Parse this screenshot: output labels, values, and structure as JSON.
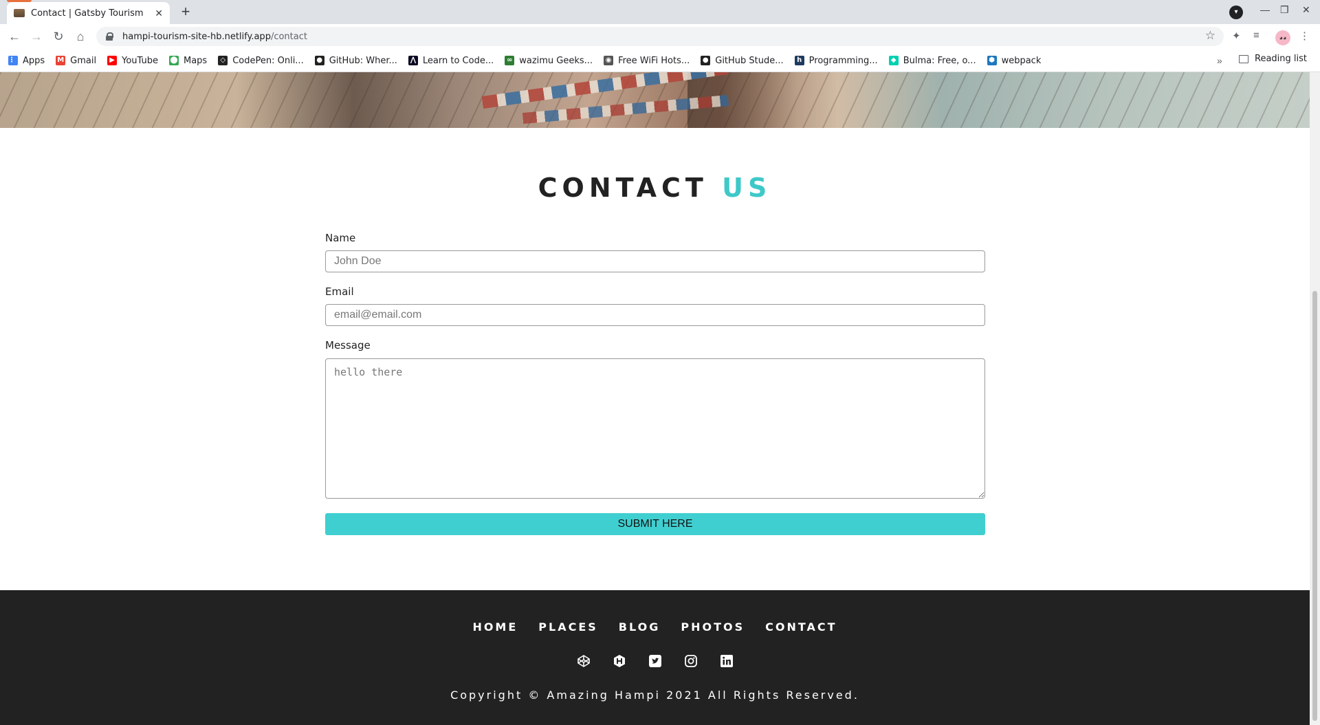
{
  "browser": {
    "tab_title": "Contact | Gatsby Tourism",
    "url_host": "hampi-tourism-site-hb.netlify.app",
    "url_path": "/contact",
    "bookmarks": [
      {
        "label": "Apps",
        "icon": "apps-grid-icon",
        "color": "#4285f4"
      },
      {
        "label": "Gmail",
        "icon": "gmail-icon",
        "color": "#ea4335"
      },
      {
        "label": "YouTube",
        "icon": "youtube-icon",
        "color": "#ff0000"
      },
      {
        "label": "Maps",
        "icon": "maps-icon",
        "color": "#34a853"
      },
      {
        "label": "CodePen: Onli...",
        "icon": "codepen-icon",
        "color": "#222222"
      },
      {
        "label": "GitHub: Wher...",
        "icon": "github-icon",
        "color": "#222222"
      },
      {
        "label": "Learn to Code...",
        "icon": "freecodecamp-icon",
        "color": "#0a0a23"
      },
      {
        "label": "wazimu Geeks...",
        "icon": "wazimu-icon",
        "color": "#2e7d32"
      },
      {
        "label": "Free WiFi Hots...",
        "icon": "wifi-globe-icon",
        "color": "#555555"
      },
      {
        "label": "GitHub Stude...",
        "icon": "github-icon",
        "color": "#222222"
      },
      {
        "label": "Programming...",
        "icon": "hashnode-icon",
        "color": "#1e3a5f"
      },
      {
        "label": "Bulma: Free, o...",
        "icon": "bulma-icon",
        "color": "#00d1b2"
      },
      {
        "label": "webpack",
        "icon": "webpack-icon",
        "color": "#1c78c0"
      }
    ],
    "reading_list": "Reading list"
  },
  "contact": {
    "title_main": "CONTACT",
    "title_accent": "US",
    "name_label": "Name",
    "name_placeholder": "John Doe",
    "email_label": "Email",
    "email_placeholder": "email@email.com",
    "message_label": "Message",
    "message_placeholder": "hello there",
    "submit_label": "SUBMIT HERE"
  },
  "footer": {
    "links": [
      "HOME",
      "PLACES",
      "BLOG",
      "PHOTOS",
      "CONTACT"
    ],
    "socials": [
      "codepen-icon",
      "hashnode-icon",
      "twitter-icon",
      "instagram-icon",
      "linkedin-icon"
    ],
    "copyright": "Copyright © Amazing Hampi 2021 All Rights Reserved."
  },
  "colors": {
    "accent": "#3fc8c8",
    "submit_bg": "#40cfd0",
    "footer_bg": "#222222"
  }
}
